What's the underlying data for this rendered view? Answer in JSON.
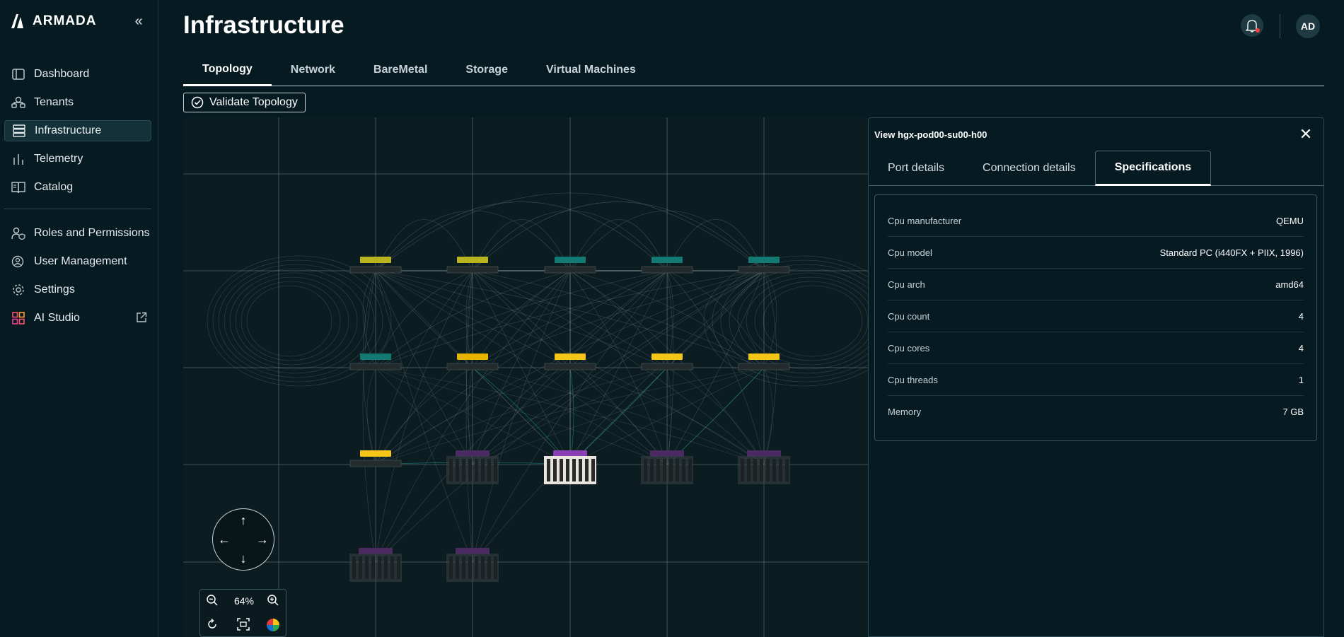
{
  "sidebar": {
    "brand": "ARMADA",
    "items": [
      {
        "label": "Dashboard",
        "icon": "dashboard-icon"
      },
      {
        "label": "Tenants",
        "icon": "tenants-icon"
      },
      {
        "label": "Infrastructure",
        "icon": "server-icon",
        "active": true
      },
      {
        "label": "Telemetry",
        "icon": "bar-chart-icon"
      },
      {
        "label": "Catalog",
        "icon": "catalog-icon"
      },
      {
        "label": "Roles and Permissions",
        "icon": "user-shield-icon"
      },
      {
        "label": "User Management",
        "icon": "user-gear-icon"
      },
      {
        "label": "Settings",
        "icon": "gear-icon"
      },
      {
        "label": "AI Studio",
        "icon": "grid-apps-icon"
      }
    ]
  },
  "header": {
    "title": "Infrastructure",
    "avatar": "AD"
  },
  "tabs": [
    {
      "label": "Topology",
      "active": true
    },
    {
      "label": "Network"
    },
    {
      "label": "BareMetal"
    },
    {
      "label": "Storage"
    },
    {
      "label": "Virtual Machines"
    }
  ],
  "toolbar": {
    "validate_label": "Validate Topology"
  },
  "canvas": {
    "zoom": "64%"
  },
  "panel": {
    "title": "View hgx-pod00-su00-h00",
    "tabs": [
      {
        "label": "Port details"
      },
      {
        "label": "Connection details"
      },
      {
        "label": "Specifications",
        "active": true
      }
    ],
    "specs": [
      {
        "key": "Cpu manufacturer",
        "value": "QEMU"
      },
      {
        "key": "Cpu model",
        "value": "Standard PC (i440FX + PIIX, 1996)"
      },
      {
        "key": "Cpu arch",
        "value": "amd64"
      },
      {
        "key": "Cpu count",
        "value": "4"
      },
      {
        "key": "Cpu cores",
        "value": "4"
      },
      {
        "key": "Cpu threads",
        "value": "1"
      },
      {
        "key": "Memory",
        "value": "7 GB"
      }
    ]
  },
  "colors": {
    "background": "#061a21",
    "canvas": "#0c1d22",
    "accent_yellow": "#f5c518",
    "accent_teal": "#1aa39a",
    "accent_purple": "#8a3fb8",
    "notification": "#ff3b3b"
  }
}
